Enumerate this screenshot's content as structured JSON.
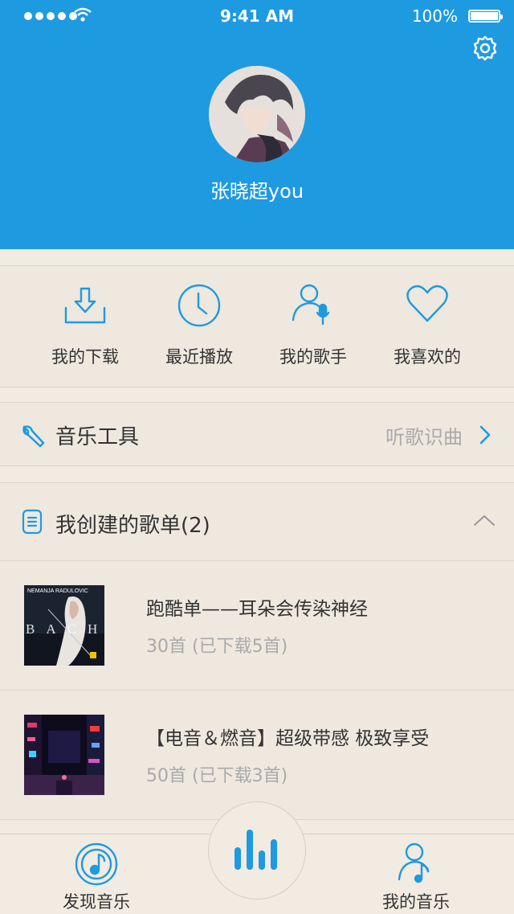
{
  "status_bar": {
    "time": "9:41 AM",
    "battery": "100%"
  },
  "profile": {
    "username": "张晓超you"
  },
  "quick_actions": [
    {
      "label": "我的下载",
      "icon": "download-icon"
    },
    {
      "label": "最近播放",
      "icon": "clock-icon"
    },
    {
      "label": "我的歌手",
      "icon": "singer-icon"
    },
    {
      "label": "我喜欢的",
      "icon": "heart-icon"
    }
  ],
  "tools": {
    "title": "音乐工具",
    "action": "听歌识曲"
  },
  "playlists": {
    "header": "我创建的歌单(2)",
    "items": [
      {
        "title": "跑酷单——耳朵会传染神经",
        "subtitle": "30首 (已下载5首)",
        "cover_text": "NEMANJA RADULOVIC",
        "cover_letters": "BACH"
      },
      {
        "title": "【电音＆燃音】超级带感 极致享受",
        "subtitle": "50首 (已下载3首)"
      }
    ]
  },
  "tabbar": {
    "discover": "发现音乐",
    "mine": "我的音乐"
  },
  "colors": {
    "primary": "#1e9ae0",
    "background": "#f1ebe2"
  }
}
